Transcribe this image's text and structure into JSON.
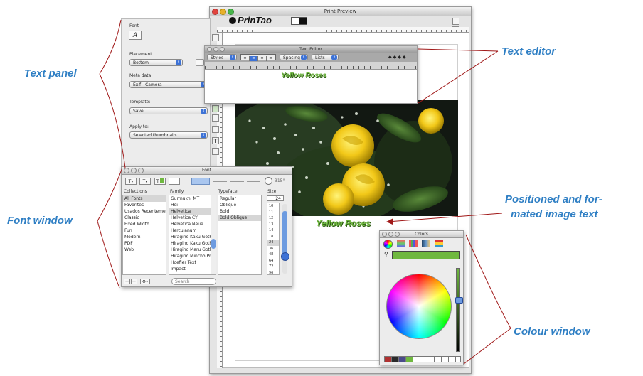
{
  "callouts": {
    "text_panel": "Text panel",
    "text_editor": "Text editor",
    "font_window": "Font window",
    "positioned_line1": "Positioned and for-",
    "positioned_line2": "mated image text",
    "colour_window": "Colour window"
  },
  "print_preview": {
    "title": "Print Preview",
    "logo": "PrinTao",
    "caption": "Yellow Roses"
  },
  "text_panel": {
    "font_label": "Font",
    "font_button": "A",
    "placement_label": "Placement",
    "placement_value": "Bottom",
    "metadata_label": "Meta data",
    "metadata_value": "Exif - Camera",
    "template_label": "Template:",
    "template_value": "Save...",
    "apply_label": "Apply to:",
    "apply_value": "Selected thumbnails"
  },
  "text_editor": {
    "title": "Text Editor",
    "styles": "Styles",
    "spacing": "Spacing",
    "lists": "Lists",
    "content": "Yellow Roses"
  },
  "font_window": {
    "title": "Font",
    "angle": "315°",
    "col_collections": "Collections",
    "col_family": "Family",
    "col_typeface": "Typeface",
    "col_size": "Size",
    "size_value": "24",
    "collections": [
      "All Fonts",
      "Favorites",
      "Usados Recentemen",
      "Classic",
      "Fixed Width",
      "Fun",
      "Modern",
      "PDF",
      "Web"
    ],
    "families": [
      "Gurmukhi MT",
      "Hei",
      "Helvetica",
      "Helvetica CY",
      "Helvetica Neue",
      "Herculanum",
      "Hiragino Kaku Gothi",
      "Hiragino Kaku Gothi",
      "Hiragino Maru Gothi",
      "Hiragino Mincho Pro",
      "Hoefler Text",
      "Impact"
    ],
    "typefaces": [
      "Regular",
      "Oblique",
      "Bold",
      "Bold Oblique"
    ],
    "sizes": [
      "10",
      "11",
      "12",
      "13",
      "14",
      "18",
      "24",
      "36",
      "48",
      "64",
      "72",
      "96"
    ],
    "search_placeholder": "Search"
  },
  "colors_window": {
    "title": "Colors"
  },
  "accent": {
    "callout_blue": "#2f7fc4",
    "line_red": "#a01818",
    "caption_green": "#6fb83f",
    "selection_blue": "#3d72d6"
  }
}
